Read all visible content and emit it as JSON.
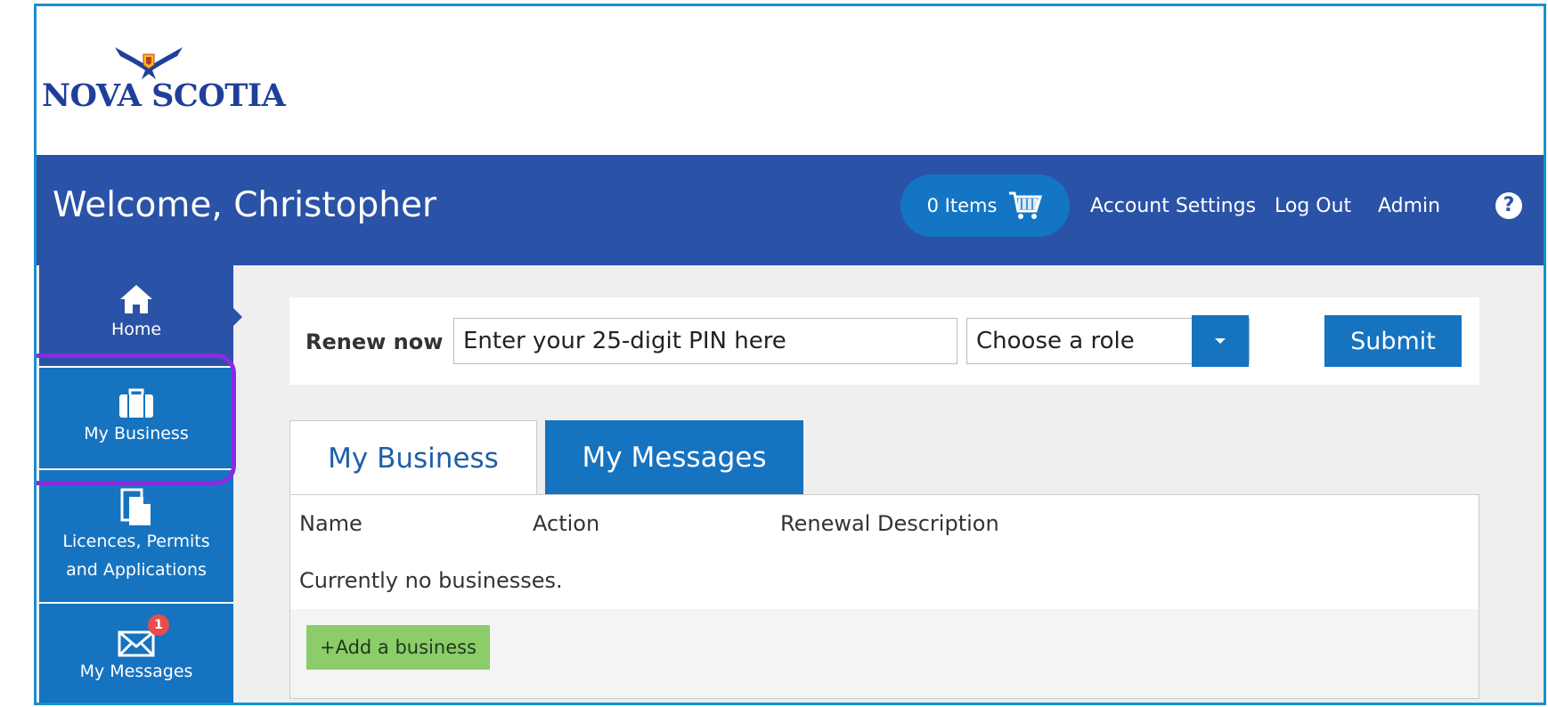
{
  "logo": {
    "text": "NOVA SCOTIA"
  },
  "header": {
    "welcome": "Welcome, Christopher",
    "cart_label": "0 Items",
    "account_settings": "Account Settings",
    "log_out": "Log Out",
    "admin": "Admin",
    "help_glyph": "?"
  },
  "sidebar": {
    "items": [
      {
        "label": "Home",
        "icon": "home-icon"
      },
      {
        "label": "My Business",
        "icon": "briefcase-icon"
      },
      {
        "label_line1": "Licences, Permits",
        "label_line2": "and Applications",
        "icon": "document-icon"
      },
      {
        "label": "My Messages",
        "icon": "envelope-icon",
        "badge": "1"
      }
    ]
  },
  "renew": {
    "label": "Renew now",
    "pin_placeholder": "Enter your 25-digit PIN here",
    "role_value": "Choose a role",
    "submit": "Submit"
  },
  "tabs": [
    {
      "label": "My Business"
    },
    {
      "label": "My Messages"
    }
  ],
  "table": {
    "columns": [
      "Name",
      "Action",
      "Renewal Description"
    ],
    "empty_text": "Currently no businesses.",
    "add_button": "+Add a business"
  },
  "colors": {
    "header": "#2a52a6",
    "nav_blue": "#1673c0",
    "add_button": "#8ccc6a",
    "highlight": "#8a2be2",
    "frame_border": "#1b8fd0"
  }
}
